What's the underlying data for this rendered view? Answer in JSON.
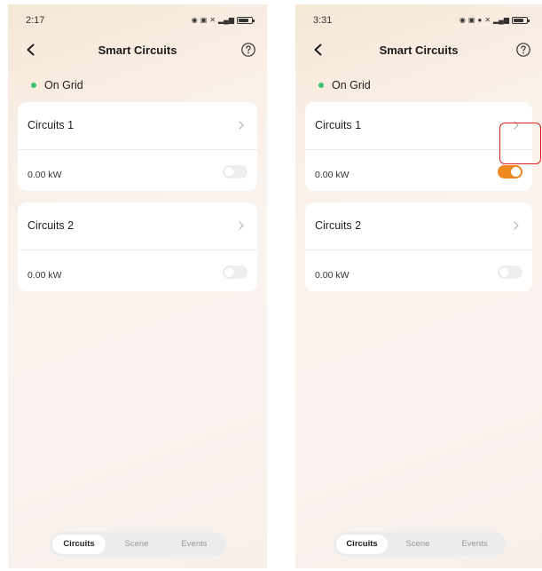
{
  "screens": [
    {
      "status_time": "2:17",
      "nav": {
        "title": "Smart Circuits"
      },
      "grid_status": "On Grid",
      "circuits": [
        {
          "name": "Circuits 1",
          "power": "0.00 kW",
          "on": false
        },
        {
          "name": "Circuits 2",
          "power": "0.00 kW",
          "on": false
        }
      ],
      "tabs": [
        "Circuits",
        "Scene",
        "Events"
      ],
      "active_tab": "Circuits"
    },
    {
      "status_time": "3:31",
      "nav": {
        "title": "Smart Circuits"
      },
      "grid_status": "On Grid",
      "circuits": [
        {
          "name": "Circuits 1",
          "power": "0.00 kW",
          "on": true
        },
        {
          "name": "Circuits 2",
          "power": "0.00 kW",
          "on": false
        }
      ],
      "tabs": [
        "Circuits",
        "Scene",
        "Events"
      ],
      "active_tab": "Circuits"
    }
  ],
  "colors": {
    "accent_orange": "#f08a1e",
    "grid_green": "#3cc36b",
    "highlight_red": "#e02121"
  },
  "icons": [
    "back-icon",
    "help-icon",
    "chevron-right-icon",
    "battery-icon",
    "signal-icon",
    "wifi-icon"
  ]
}
